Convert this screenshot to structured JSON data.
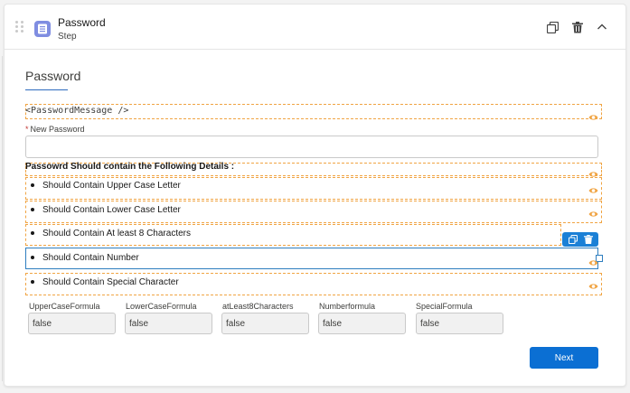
{
  "header": {
    "title": "Password",
    "subtitle": "Step",
    "icon": "list-icon",
    "actions": [
      "copy-icon",
      "trash-icon",
      "chevron-up-icon"
    ]
  },
  "section": {
    "title": "Password"
  },
  "component": {
    "code": "<PasswordMessage />"
  },
  "new_password": {
    "required_marker": "*",
    "label": "New Password",
    "value": ""
  },
  "details": {
    "heading": "Passowrd Should contain the Following Details :",
    "bullets": [
      "Should Contain Upper Case Letter",
      "Should Contain Lower Case Letter",
      "Should Contain At least 8 Characters",
      "Should Contain Number",
      "Should Contain Special Character"
    ]
  },
  "formulas": [
    {
      "label": "UpperCaseFormula",
      "value": "false"
    },
    {
      "label": "LowerCaseFormula",
      "value": "false"
    },
    {
      "label": "atLeast8Characters",
      "value": "false"
    },
    {
      "label": "Numberformula",
      "value": "false"
    },
    {
      "label": "SpecialFormula",
      "value": "false"
    }
  ],
  "footer": {
    "next_label": "Next"
  },
  "colors": {
    "accent": "#0b6fd3",
    "dashed_border": "#f0a443",
    "selection": "#2e7ebf",
    "step_icon": "#7f8de1"
  }
}
